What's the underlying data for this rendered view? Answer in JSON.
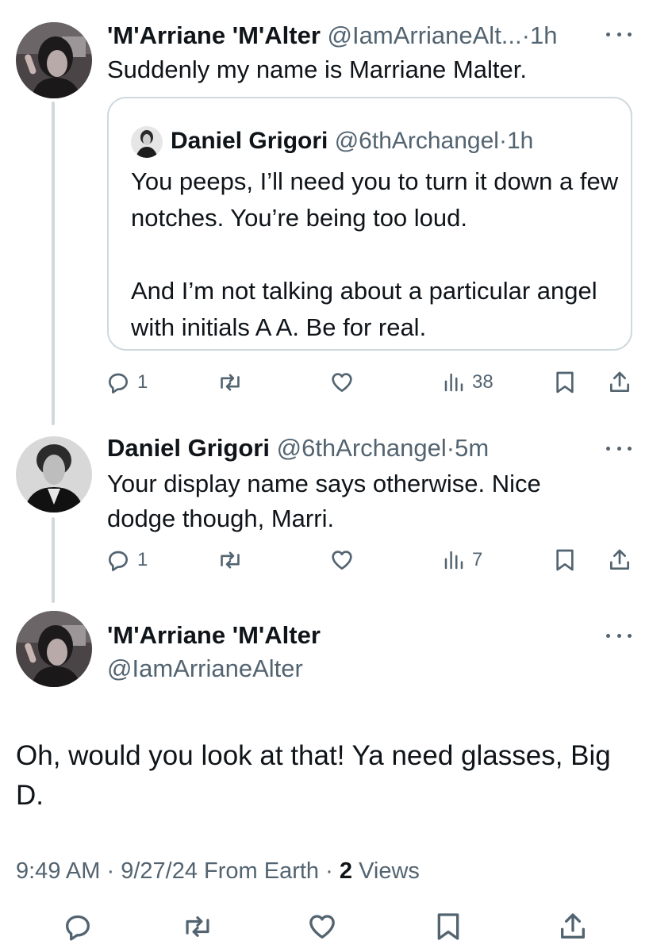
{
  "tweet1": {
    "name": "'M'Arriane 'M'Alter",
    "handle": "@IamArrianeAlt...",
    "dot": "·",
    "time": "1h",
    "text": "Suddenly my name is Marriane Malter.",
    "quote": {
      "name": "Daniel Grigori",
      "handle": "@6thArchangel",
      "dot": "·",
      "time": "1h",
      "paragraph1": "You peeps, I’ll need you to turn it down a few notches. You’re being too loud.",
      "paragraph2": "And I’m not talking about a particular angel with initials A A. Be for real."
    },
    "actions": {
      "replies": "1",
      "views": "38"
    }
  },
  "tweet2": {
    "name": "Daniel Grigori",
    "handle": "@6thArchangel",
    "dot": "·",
    "time": "5m",
    "text": "Your display name says otherwise. Nice dodge though, Marri.",
    "actions": {
      "replies": "1",
      "views": "7"
    }
  },
  "main_tweet": {
    "name": "'M'Arriane 'M'Alter",
    "handle": "@IamArrianeAlter",
    "text": "Oh, would you look at that! Ya need glasses, Big D.",
    "meta": {
      "time": "9:49 AM",
      "sep1": "·",
      "date": "9/27/24",
      "source": "From Earth",
      "sep2": "·",
      "views_count": "2",
      "views_label": "Views"
    }
  },
  "colors": {
    "text_primary": "#0f1419",
    "text_secondary": "#536471",
    "border": "#cfd9de"
  },
  "icons": [
    "more-icon",
    "reply-icon",
    "repost-icon",
    "like-icon",
    "views-icon",
    "bookmark-icon",
    "share-icon"
  ]
}
